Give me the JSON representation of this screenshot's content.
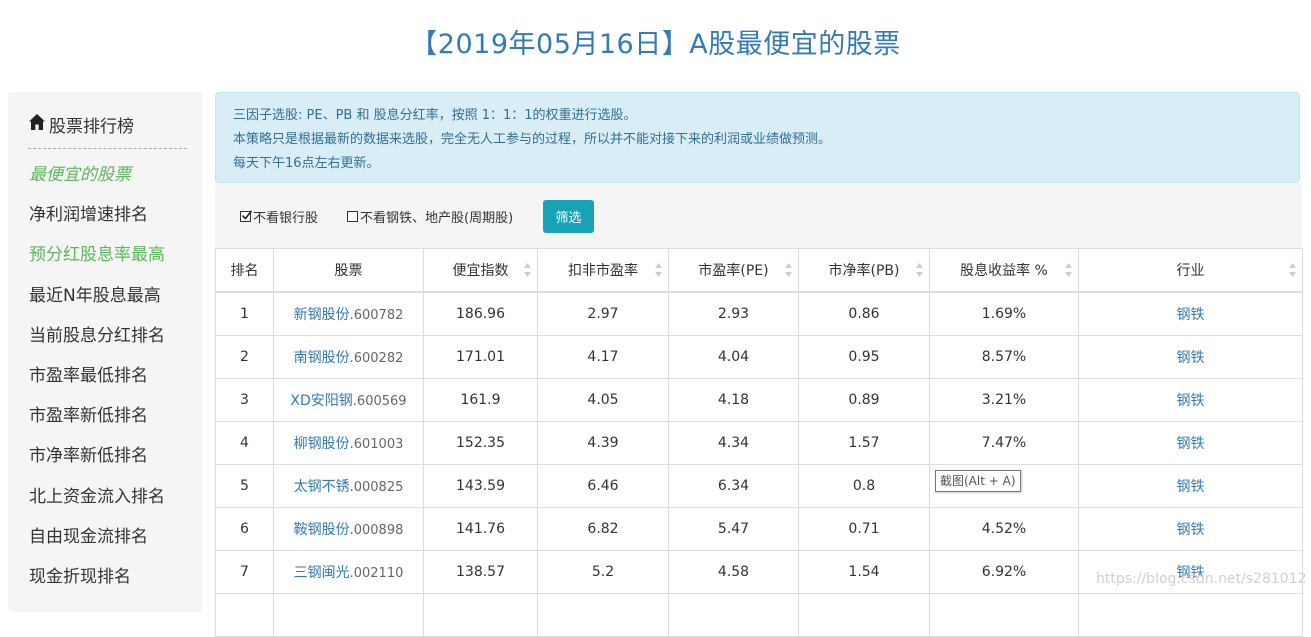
{
  "title": "【2019年05月16日】A股最便宜的股票",
  "sidebar": {
    "header": "股票排行榜",
    "items": [
      {
        "label": "最便宜的股票",
        "state": "active"
      },
      {
        "label": "净利润增速排名",
        "state": "normal"
      },
      {
        "label": "预分红股息率最高",
        "state": "green"
      },
      {
        "label": "最近N年股息最高",
        "state": "normal"
      },
      {
        "label": "当前股息分红排名",
        "state": "normal"
      },
      {
        "label": "市盈率最低排名",
        "state": "normal"
      },
      {
        "label": "市盈率新低排名",
        "state": "normal"
      },
      {
        "label": "市净率新低排名",
        "state": "normal"
      },
      {
        "label": "北上资金流入排名",
        "state": "normal"
      },
      {
        "label": "自由现金流排名",
        "state": "normal"
      },
      {
        "label": "现金折现排名",
        "state": "normal"
      }
    ]
  },
  "info": {
    "line1": "三因子选股: PE、PB 和 股息分红率，按照 1：1：1的权重进行选股。",
    "line2": "本策略只是根据最新的数据来选股，完全无人工参与的过程，所以并不能对接下来的利润或业绩做预测。",
    "line3": "每天下午16点左右更新。"
  },
  "filters": {
    "exclude_banks": {
      "label": "不看银行股",
      "checked": true
    },
    "exclude_steel": {
      "label": "不看钢铁、地产股(周期股)",
      "checked": false
    },
    "button": "筛选"
  },
  "table": {
    "columns": [
      "排名",
      "股票",
      "便宜指数",
      "扣非市盈率",
      "市盈率(PE)",
      "市净率(PB)",
      "股息收益率 %",
      "行业"
    ],
    "rows": [
      {
        "rank": "1",
        "name": "新钢股份",
        "code": ".600782",
        "index": "186.96",
        "pe_deducted": "2.97",
        "pe": "2.93",
        "pb": "0.86",
        "dividend": "1.69%",
        "industry": "钢铁"
      },
      {
        "rank": "2",
        "name": "南钢股份",
        "code": ".600282",
        "index": "171.01",
        "pe_deducted": "4.17",
        "pe": "4.04",
        "pb": "0.95",
        "dividend": "8.57%",
        "industry": "钢铁"
      },
      {
        "rank": "3",
        "name": "XD安阳钢",
        "code": ".600569",
        "index": "161.9",
        "pe_deducted": "4.05",
        "pe": "4.18",
        "pb": "0.89",
        "dividend": "3.21%",
        "industry": "钢铁"
      },
      {
        "rank": "4",
        "name": "柳钢股份",
        "code": ".601003",
        "index": "152.35",
        "pe_deducted": "4.39",
        "pe": "4.34",
        "pb": "1.57",
        "dividend": "7.47%",
        "industry": "钢铁"
      },
      {
        "rank": "5",
        "name": "太钢不锈",
        "code": ".000825",
        "index": "143.59",
        "pe_deducted": "6.46",
        "pe": "6.34",
        "pb": "0.8",
        "dividend": "",
        "industry": "钢铁"
      },
      {
        "rank": "6",
        "name": "鞍钢股份",
        "code": ".000898",
        "index": "141.76",
        "pe_deducted": "6.82",
        "pe": "5.47",
        "pb": "0.71",
        "dividend": "4.52%",
        "industry": "钢铁"
      },
      {
        "rank": "7",
        "name": "三钢闽光",
        "code": ".002110",
        "index": "138.57",
        "pe_deducted": "5.2",
        "pe": "4.58",
        "pb": "1.54",
        "dividend": "6.92%",
        "industry": "钢铁"
      }
    ]
  },
  "tooltip": "截图(Alt + A)",
  "watermark": "https://blog.csdn.net/s281012"
}
